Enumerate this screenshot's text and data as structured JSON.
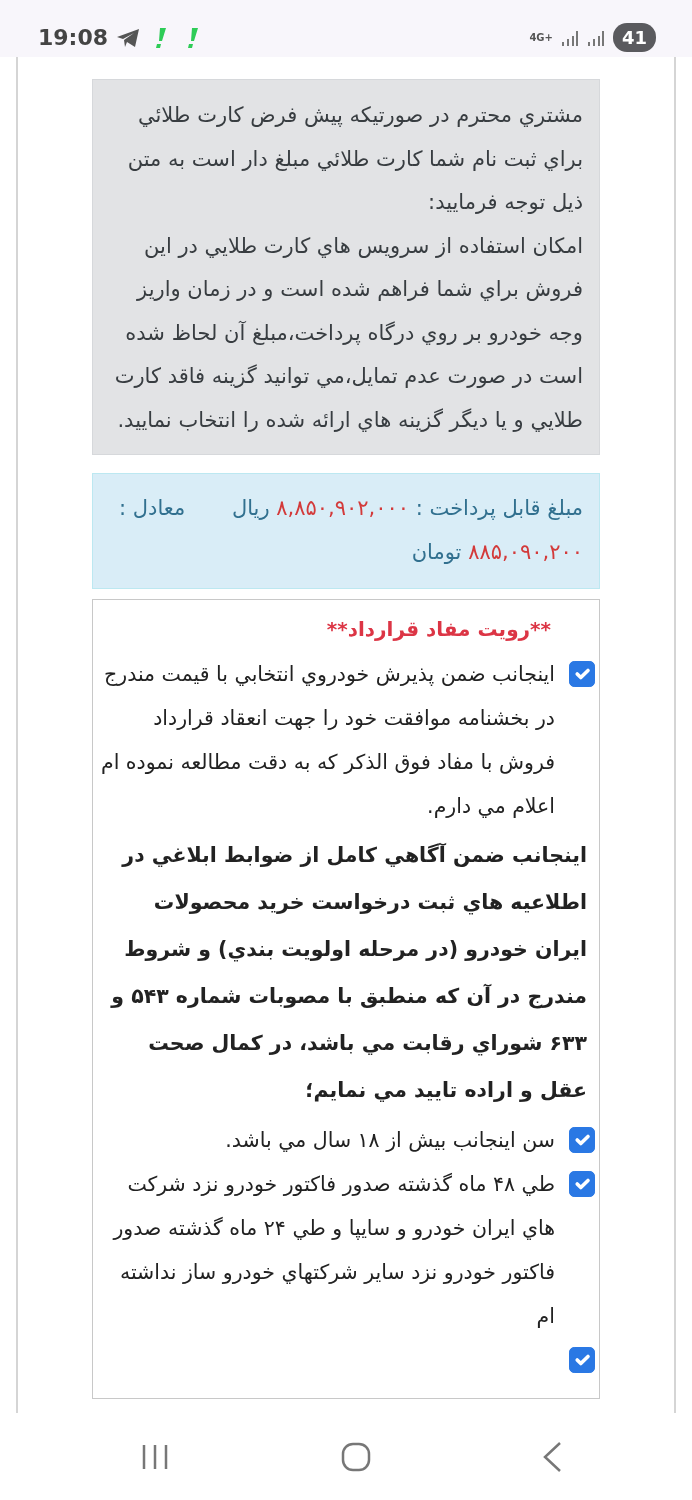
{
  "status_bar": {
    "time": "19:08",
    "network": "4G+",
    "battery": "41"
  },
  "notice": {
    "paragraphs": [
      "مشتري محترم در صورتيكه پيش فرض كارت طلائي براي ثبت نام شما كارت طلائي مبلغ دار است به متن ذيل توجه فرماييد:",
      "امكان استفاده از سرويس هاي كارت طلايي در اين فروش براي شما فراهم شده است و در زمان واريز وجه خودرو بر روي درگاه پرداخت،مبلغ آن لحاظ شده است در صورت عدم تمايل،مي توانيد گزينه فاقد كارت طلايي و يا ديگر گزينه هاي ارائه شده را انتخاب نماييد."
    ]
  },
  "payment": {
    "segments": [
      {
        "kind": "label",
        "text": "مبلغ قابل پرداخت :"
      },
      {
        "kind": "amount",
        "text": "۸,۸۵۰,۹۰۲,۰۰۰"
      },
      {
        "kind": "label",
        "text": "ريال"
      },
      {
        "kind": "label",
        "text": "معادل :"
      },
      {
        "kind": "amount",
        "text": "۸۸۵,۰۹۰,۲۰۰"
      },
      {
        "kind": "label",
        "text": "تومان"
      }
    ]
  },
  "contract": {
    "title": "**رويت مفاد قرارداد**",
    "items": [
      {
        "kind": "checkbox",
        "checked": true,
        "label": "اينجانب ضمن پذيرش خودروي انتخابي با قيمت مندرج در بخشنامه موافقت خود را جهت انعقاد قرارداد فروش با مفاد فوق الذكر كه به دقت مطالعه نموده ام اعلام مي دارم."
      },
      {
        "kind": "statement",
        "text": "اينجانب ضمن آگاهي كامل از ضوابط ابلاغي در اطلاعيه هاي ثبت درخواست خريد محصولات ايران خودرو (در مرحله اولويت بندي) و شروط مندرج در آن كه منطبق با مصوبات شماره ۵۴۳ و ۶۳۳ شوراي رقابت مي باشد، در كمال صحت عقل و اراده تاييد مي نمايم؛"
      },
      {
        "kind": "checkbox",
        "checked": true,
        "label": "سن اينجانب بيش از ۱۸ سال مي باشد."
      },
      {
        "kind": "checkbox",
        "checked": true,
        "label": "طي ۴۸ ماه گذشته صدور فاكتور خودرو نزد شركت هاي ايران خودرو و سايپا و طي ۲۴ ماه گذشته صدور فاكتور خودرو نزد ساير شركتهاي خودرو ساز نداشته ام"
      },
      {
        "kind": "checkbox",
        "checked": true
      }
    ]
  }
}
